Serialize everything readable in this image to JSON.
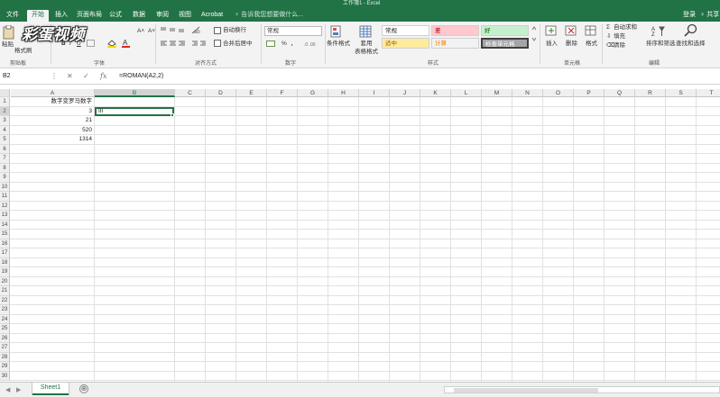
{
  "window": {
    "title": "工作簿1 - Excel"
  },
  "tabs": [
    {
      "label": "文件"
    },
    {
      "label": "开始"
    },
    {
      "label": "插入"
    },
    {
      "label": "页面布局"
    },
    {
      "label": "公式"
    },
    {
      "label": "数据"
    },
    {
      "label": "审阅"
    },
    {
      "label": "视图"
    },
    {
      "label": "Acrobat"
    }
  ],
  "tell_me": "♀ 告诉我您想要做什么...",
  "account": {
    "login": "登录",
    "share": "♀ 共享"
  },
  "watermark": "彩蛋视频",
  "ribbon": {
    "clipboard": {
      "paste": "粘贴",
      "format_painter": "格式刷",
      "label": "剪贴板"
    },
    "font": {
      "bold": "B",
      "italic": "I",
      "underline": "U",
      "grow": "A˄",
      "shrink": "A˅",
      "label": "字体"
    },
    "alignment": {
      "wrap": "自动换行",
      "merge": "合并后居中",
      "label": "对齐方式"
    },
    "number": {
      "format": "常规",
      "percent": "%",
      "comma": "，",
      "label": "数字"
    },
    "styles": {
      "conditional": "条件格式",
      "table": "套用\n表格格式",
      "cells": [
        {
          "name": "常规",
          "bg": "#ffffff",
          "color": "#222222"
        },
        {
          "name": "差",
          "bg": "#ffc7ce",
          "color": "#9c0006"
        },
        {
          "name": "好",
          "bg": "#c6efce",
          "color": "#006100"
        },
        {
          "name": "适中",
          "bg": "#ffeb9c",
          "color": "#9c5700"
        },
        {
          "name": "计算",
          "bg": "#f2f2f2",
          "color": "#fa7d00"
        },
        {
          "name": "检查单元格",
          "bg": "#a5a5a5",
          "color": "#ffffff"
        }
      ],
      "label": "样式"
    },
    "cells": {
      "insert": "插入",
      "delete": "删除",
      "format": "格式",
      "label": "单元格"
    },
    "editing": {
      "autosum": "自动求和",
      "fill": "填充",
      "clear": "清除",
      "sort": "排序和筛选",
      "find": "查找和选择",
      "label": "编辑"
    }
  },
  "formula_bar": {
    "name_box": "B2",
    "formula": "=ROMAN(A2,2)"
  },
  "sheet": {
    "columns": [
      "A",
      "B",
      "C",
      "D",
      "E",
      "F",
      "G",
      "H",
      "I",
      "J",
      "K",
      "L",
      "M",
      "N",
      "O",
      "P",
      "Q",
      "R",
      "S",
      "T"
    ],
    "rows": [
      "1",
      "2",
      "3",
      "4",
      "5",
      "6",
      "7",
      "8",
      "9",
      "10",
      "11",
      "12",
      "13",
      "14",
      "15",
      "16",
      "17",
      "18",
      "19",
      "20",
      "21",
      "22",
      "23",
      "24",
      "25",
      "26",
      "27",
      "28",
      "29",
      "30"
    ],
    "selected_column": "B",
    "selected_row": "2",
    "cells": {
      "A1": "数字变罗马数字",
      "A2": "3",
      "B2": "III",
      "A3": "21",
      "A4": "520",
      "A5": "1314"
    }
  },
  "sheet_tabs": [
    {
      "name": "Sheet1"
    }
  ],
  "add_sheet": "⊕",
  "colors": {
    "accent": "#217346"
  }
}
